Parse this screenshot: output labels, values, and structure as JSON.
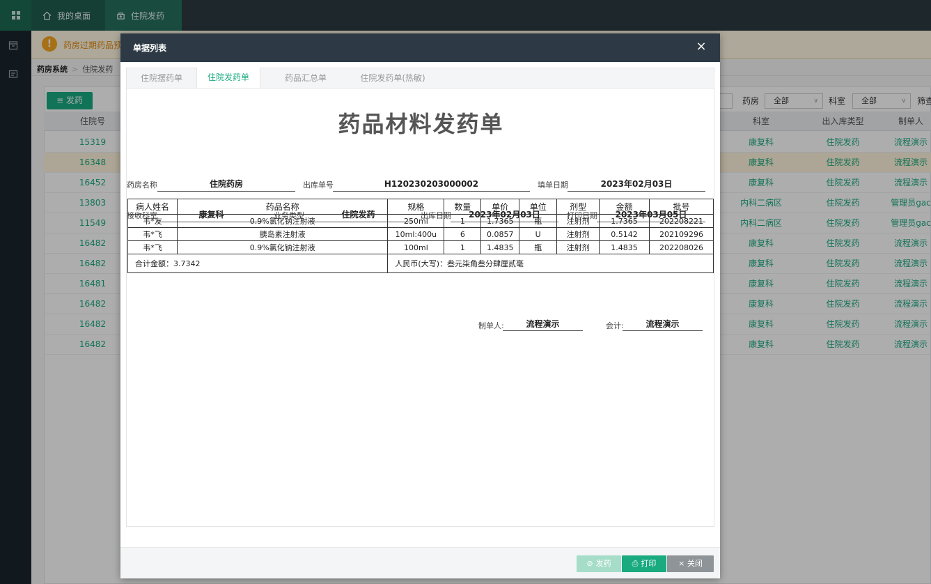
{
  "topbar": {
    "tabs": [
      {
        "label": "我的桌面",
        "icon": "home-icon"
      },
      {
        "label": "住院发药",
        "icon": "pharmacy-icon"
      }
    ]
  },
  "notice": {
    "text": "药房过期药品预"
  },
  "breadcrumb": {
    "root": "药房系统",
    "current": "住院发药"
  },
  "toolbar": {
    "issue_label": "≡ 发药",
    "pharmacy_label": "药房",
    "pharmacy_value": "全部",
    "dept_label": "科室",
    "dept_value": "全部",
    "filter_label": "筛查"
  },
  "grid": {
    "columns": {
      "inpatient_no": "住院号",
      "dept": "科室",
      "io_type": "出入库类型",
      "creator": "制单人"
    },
    "rows": [
      {
        "no": "15319",
        "dept": "康复科",
        "type": "住院发药",
        "creator": "流程演示"
      },
      {
        "no": "16348",
        "dept": "康复科",
        "type": "住院发药",
        "creator": "流程演示"
      },
      {
        "no": "16452",
        "dept": "康复科",
        "type": "住院发药",
        "creator": "流程演示"
      },
      {
        "no": "13803",
        "dept": "内科二病区",
        "type": "住院发药",
        "creator": "管理员gac"
      },
      {
        "no": "11549",
        "dept": "内科二病区",
        "type": "住院发药",
        "creator": "管理员gac"
      },
      {
        "no": "16482",
        "dept": "康复科",
        "type": "住院发药",
        "creator": "流程演示"
      },
      {
        "no": "16482",
        "dept": "康复科",
        "type": "住院发药",
        "creator": "流程演示"
      },
      {
        "no": "16481",
        "dept": "康复科",
        "type": "住院发药",
        "creator": "流程演示"
      },
      {
        "no": "16482",
        "dept": "康复科",
        "type": "住院发药",
        "creator": "流程演示"
      },
      {
        "no": "16482",
        "dept": "康复科",
        "type": "住院发药",
        "creator": "流程演示"
      },
      {
        "no": "16482",
        "dept": "康复科",
        "type": "住院发药",
        "creator": "流程演示"
      }
    ]
  },
  "modal": {
    "title": "单据列表",
    "close_glyph": "×",
    "tabs": [
      "住院摆药单",
      "住院发药单",
      "药品汇总单",
      "住院发药单(热敏)"
    ],
    "active_tab": 1,
    "footer": {
      "issue_label": "发药",
      "print_label": "打印",
      "close_label": "× 关闭"
    }
  },
  "document": {
    "title": "药品材料发药单",
    "pharmacy_label": "药房名称",
    "pharmacy_value": "住院药房",
    "outbound_no_label": "出库单号",
    "outbound_no_value": "H120230203000002",
    "fill_date_label": "填单日期",
    "fill_date_value": "2023年02月03日",
    "receive_dept_label": "接收科室",
    "receive_dept_value": "康复科",
    "biz_type_label": "业务类型",
    "biz_type_value": "住院发药",
    "outbound_date_label": "出库日期",
    "outbound_date_value": "2023年02月03日",
    "print_date_label": "打印日期",
    "print_date_value": "2023年03月05日",
    "table_headers": [
      "病人姓名",
      "药品名称",
      "规格",
      "数量",
      "单价",
      "单位",
      "剂型",
      "金额",
      "批号"
    ],
    "items": [
      [
        "韦*友",
        "0.9%氯化钠注射液",
        "250ml",
        "1",
        "1.7365",
        "瓶",
        "注射剂",
        "1.7365",
        "202208221"
      ],
      [
        "韦*飞",
        "胰岛素注射液",
        "10ml:400u",
        "6",
        "0.0857",
        "U",
        "注射剂",
        "0.5142",
        "202109296"
      ],
      [
        "韦*飞",
        "0.9%氯化钠注射液",
        "100ml",
        "1",
        "1.4835",
        "瓶",
        "注射剂",
        "1.4835",
        "202208026"
      ]
    ],
    "total_text": "合计金额：3.7342",
    "rmb_text": "人民币(大写)：叁元柒角叁分肆厘贰毫",
    "maker_label": "制单人:",
    "maker_value": "流程演示",
    "accountant_label": "会计:",
    "accountant_value": "流程演示"
  }
}
